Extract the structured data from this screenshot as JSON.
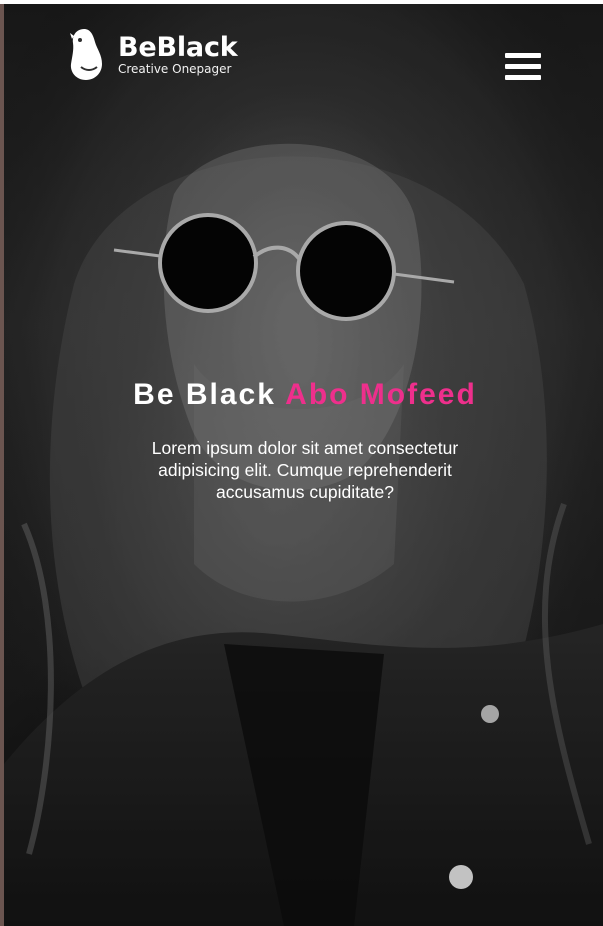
{
  "brand": {
    "name": "BeBlack",
    "tagline": "Creative Onepager",
    "logo_icon": "beaver-icon"
  },
  "nav": {
    "menu_icon": "hamburger-menu-icon"
  },
  "hero": {
    "title_main": "Be Black",
    "title_accent": "Abo Mofeed",
    "text": "Lorem ipsum dolor sit amet consectetur adipisicing elit. Cumque reprehenderit accusamus cupiditate?",
    "background_image": "black-and-white portrait of man with long curly hair and round sunglasses"
  },
  "colors": {
    "accent": "#ee2f8c",
    "text": "#ffffff",
    "background": "#1f1f1f"
  }
}
